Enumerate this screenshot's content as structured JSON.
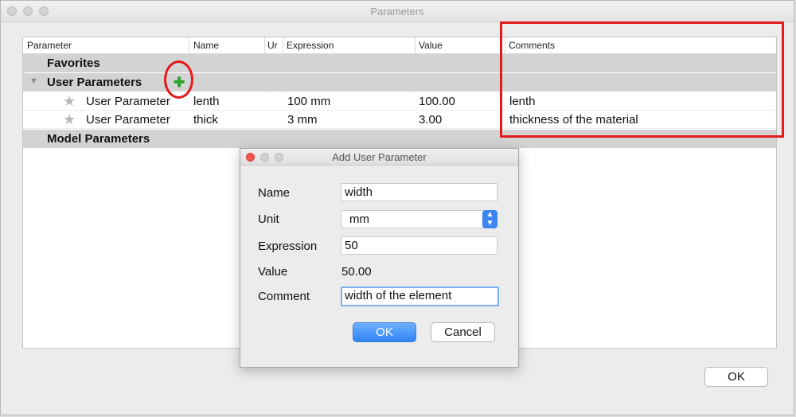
{
  "window": {
    "title": "Parameters",
    "ok_label": "OK"
  },
  "table": {
    "columns": [
      "Parameter",
      "Name",
      "Ur",
      "Expression",
      "Value",
      "Comments"
    ],
    "groups": {
      "favorites": "Favorites",
      "user_parameters": "User Parameters",
      "model_parameters": "Model Parameters"
    },
    "rows": [
      {
        "parameter": "User Parameter",
        "name": "lenth",
        "expression": "100 mm",
        "value": "100.00",
        "comment": "lenth"
      },
      {
        "parameter": "User Parameter",
        "name": "thick",
        "expression": "3 mm",
        "value": "3.00",
        "comment": "thickness of the material"
      }
    ]
  },
  "dialog": {
    "title": "Add User Parameter",
    "labels": {
      "name": "Name",
      "unit": "Unit",
      "expression": "Expression",
      "value": "Value",
      "comment": "Comment"
    },
    "values": {
      "name": "width",
      "unit": "mm",
      "expression": "50",
      "value": "50.00",
      "comment": "width of the element"
    },
    "ok_label": "OK",
    "cancel_label": "Cancel"
  },
  "colors": {
    "annotation": "#e31b1b",
    "add_icon": "#2da12d",
    "accent": "#3d86f2"
  },
  "icons": {
    "add": "plus-icon",
    "favorite": "star-icon",
    "expand": "disclosure-triangle-icon"
  }
}
